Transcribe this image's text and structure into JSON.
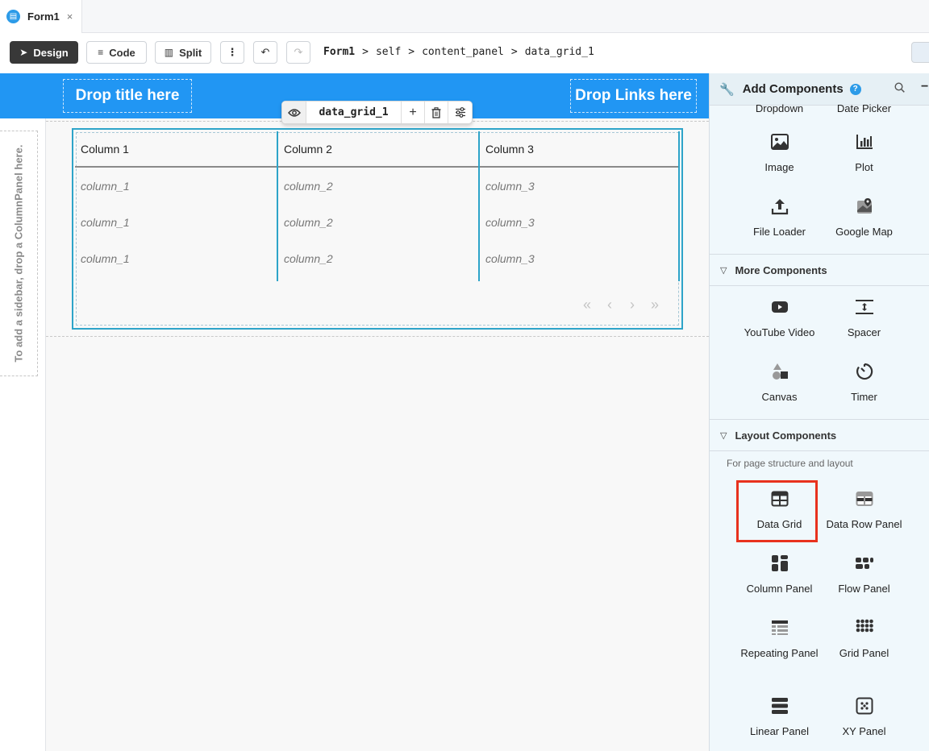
{
  "tab": {
    "label": "Form1",
    "close": "×"
  },
  "toolbar": {
    "design": "Design",
    "code": "Code",
    "split": "Split",
    "more": "⋮",
    "undo": "↶",
    "redo": "↷"
  },
  "breadcrumb": {
    "form": "Form1",
    "self": "self",
    "panel": "content_panel",
    "component": "data_grid_1",
    "sep": ">"
  },
  "header": {
    "drop_title": "Drop title here",
    "drop_links": "Drop Links here"
  },
  "sidebar_hint": "To add a sidebar, drop a ColumnPanel here.",
  "component_toolbar": {
    "name": "data_grid_1",
    "add": "+"
  },
  "grid": {
    "columns": [
      "Column 1",
      "Column 2",
      "Column 3"
    ],
    "rows": [
      [
        "column_1",
        "column_2",
        "column_3"
      ],
      [
        "column_1",
        "column_2",
        "column_3"
      ],
      [
        "column_1",
        "column_2",
        "column_3"
      ]
    ],
    "pager": [
      "«",
      "‹",
      "›",
      "»"
    ]
  },
  "panel": {
    "title": "Add Components",
    "help": "?",
    "top_items": [
      "Dropdown",
      "Date Picker"
    ],
    "basic_items": [
      "Image",
      "Plot",
      "File Loader",
      "Google Map"
    ],
    "more_section": "More Components",
    "more_items": [
      "YouTube Video",
      "Spacer",
      "Canvas",
      "Timer"
    ],
    "layout_section": "Layout Components",
    "layout_hint": "For page structure and layout",
    "layout_items": [
      "Data Grid",
      "Data Row Panel",
      "Column Panel",
      "Flow Panel",
      "Repeating Panel",
      "Grid Panel",
      "Linear Panel",
      "XY Panel"
    ]
  },
  "colors": {
    "header_blue": "#2196f3",
    "selection_teal": "#2ea4c9",
    "highlight_red": "#e8321e"
  }
}
